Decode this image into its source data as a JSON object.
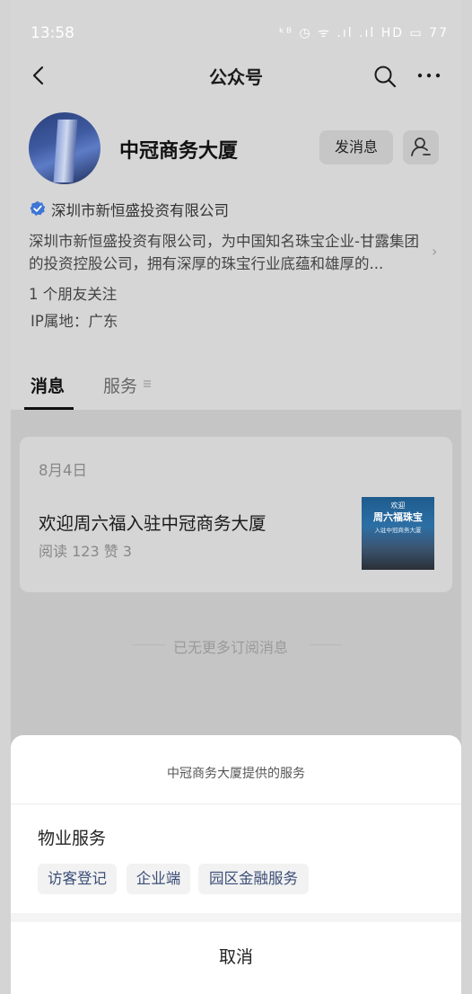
{
  "status_bar": {
    "time": "13:58",
    "icons": "ᵏᴮ ◷ ᯤ .ıl .ıl HD ▭ 77"
  },
  "nav": {
    "title": "公众号"
  },
  "profile": {
    "name": "中冠商务大厦",
    "message_button": "发消息",
    "company": "深圳市新恒盛投资有限公司",
    "description": "深圳市新恒盛投资有限公司，为中国知名珠宝企业-甘露集团的投资控股公司，拥有深厚的珠宝行业底蕴和雄厚的...",
    "friends_following": "1 个朋友关注",
    "ip_location": "IP属地：广东"
  },
  "tabs": [
    {
      "label": "消息"
    },
    {
      "label": "服务"
    }
  ],
  "feed": {
    "date": "8月4日",
    "article": {
      "title": "欢迎周六福入驻中冠商务大厦",
      "stats": "阅读 123   赞 3",
      "thumb_line1": "欢迎",
      "thumb_line2": "周六福珠宝",
      "thumb_line3": "入驻中冠商务大厦"
    },
    "end_text": "已无更多订阅消息"
  },
  "sheet": {
    "title": "中冠商务大厦提供的服务",
    "group_title": "物业服务",
    "chips": [
      "访客登记",
      "企业端",
      "园区金融服务"
    ],
    "cancel": "取消"
  },
  "colors": {
    "overlay_bg": "#d4d4d4",
    "chip_text": "#3b4e78",
    "verified": "#3d76d6"
  }
}
